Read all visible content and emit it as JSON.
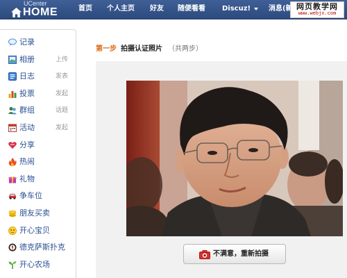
{
  "header": {
    "logo_small": "UCenter",
    "logo_big": "HOME",
    "nav": [
      "首页",
      "个人主页",
      "好友",
      "随便看看",
      "Discuz!",
      "消息(新"
    ],
    "watermark_title": "网页教学网",
    "watermark_url": "www.webjx.com"
  },
  "sidebar": {
    "items": [
      {
        "label": "记录",
        "extra": "",
        "icon": "speech-bubble-icon"
      },
      {
        "label": "相册",
        "extra": "上传",
        "icon": "photo-icon"
      },
      {
        "label": "日志",
        "extra": "发表",
        "icon": "blog-icon"
      },
      {
        "label": "投票",
        "extra": "发起",
        "icon": "poll-icon"
      },
      {
        "label": "群组",
        "extra": "话题",
        "icon": "group-icon"
      },
      {
        "label": "活动",
        "extra": "发起",
        "icon": "calendar-icon"
      },
      {
        "label": "分享",
        "extra": "",
        "icon": "share-heart-icon"
      },
      {
        "label": "热闹",
        "extra": "",
        "icon": "fire-icon"
      },
      {
        "label": "礼物",
        "extra": "",
        "icon": "gift-icon"
      },
      {
        "label": "争车位",
        "extra": "",
        "icon": "car-icon"
      },
      {
        "label": "朋友买卖",
        "extra": "",
        "icon": "coin-icon"
      },
      {
        "label": "开心宝贝",
        "extra": "",
        "icon": "baby-icon"
      },
      {
        "label": "德克萨斯扑克",
        "extra": "",
        "icon": "poker-icon"
      },
      {
        "label": "开心农场",
        "extra": "",
        "icon": "sprout-icon"
      }
    ]
  },
  "main": {
    "step_no": "第一步",
    "step_title": "拍摄认证照片",
    "step_count": "（共两步）",
    "retake_label": "不满意，重新拍摄"
  },
  "colors": {
    "nav_bg": "#2f4f85",
    "link": "#2a4f93",
    "step_accent": "#d86a1a",
    "panel_bg": "#f1f1f1"
  }
}
